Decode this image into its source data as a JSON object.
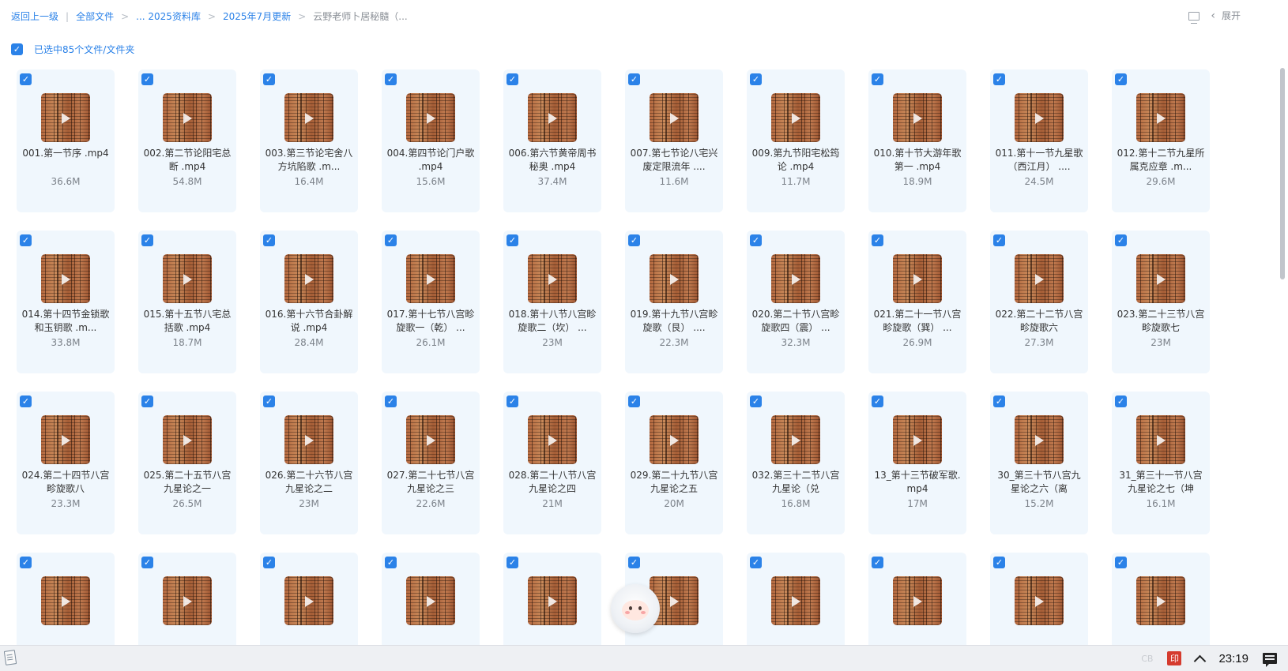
{
  "breadcrumb": {
    "back": "返回上一级",
    "sep1": "|",
    "all": "全部文件",
    "lib": "... 2025资料库",
    "month": "2025年7月更新",
    "current": "云野老师卜居秘髓（..."
  },
  "header": {
    "expand_label": "展开"
  },
  "selection": {
    "text": "已选中85个文件/文件夹"
  },
  "files": [
    {
      "name": "001.第一节序 .mp4",
      "size": "36.6M"
    },
    {
      "name": "002.第二节论阳宅总断 .mp4",
      "size": "54.8M"
    },
    {
      "name": "003.第三节论宅舍八方坑陷歌 .m...",
      "size": "16.4M"
    },
    {
      "name": "004.第四节论门户歌 .mp4",
      "size": "15.6M"
    },
    {
      "name": "006.第六节黄帝周书秘奥 .mp4",
      "size": "37.4M"
    },
    {
      "name": "007.第七节论八宅兴废定限流年 ....",
      "size": "11.6M"
    },
    {
      "name": "009.第九节阳宅松筠论 .mp4",
      "size": "11.7M"
    },
    {
      "name": "010.第十节大游年歌第一 .mp4",
      "size": "18.9M"
    },
    {
      "name": "011.第十一节九星歌（西江月） ....",
      "size": "24.5M"
    },
    {
      "name": "012.第十二节九星所属克应章 .m...",
      "size": "29.6M"
    },
    {
      "name": "014.第十四节金锁歌和玉钥歌 .m...",
      "size": "33.8M"
    },
    {
      "name": "015.第十五节八宅总括歌 .mp4",
      "size": "18.7M"
    },
    {
      "name": "016.第十六节合卦解说 .mp4",
      "size": "28.4M"
    },
    {
      "name": "017.第十七节八宫畛旋歌一（乾） ...",
      "size": "26.1M"
    },
    {
      "name": "018.第十八节八宫畛旋歌二（坎） ...",
      "size": "23M"
    },
    {
      "name": "019.第十九节八宫畛旋歌（艮） ....",
      "size": "22.3M"
    },
    {
      "name": "020.第二十节八宫畛旋歌四（震） ...",
      "size": "32.3M"
    },
    {
      "name": "021.第二十一节八宫畛旋歌（巽） ...",
      "size": "26.9M"
    },
    {
      "name": "022.第二十二节八宫畛旋歌六",
      "size": "27.3M"
    },
    {
      "name": "023.第二十三节八宫畛旋歌七",
      "size": "23M"
    },
    {
      "name": "024.第二十四节八宫畛旋歌八",
      "size": "23.3M"
    },
    {
      "name": "025.第二十五节八宫九星论之一",
      "size": "26.5M"
    },
    {
      "name": "026.第二十六节八宫九星论之二",
      "size": "23M"
    },
    {
      "name": "027.第二十七节八宫九星论之三",
      "size": "22.6M"
    },
    {
      "name": "028.第二十八节八宫九星论之四",
      "size": "21M"
    },
    {
      "name": "029.第二十九节八宫九星论之五",
      "size": "20M"
    },
    {
      "name": "032.第三十二节八宫九星论（兑",
      "size": "16.8M"
    },
    {
      "name": "13_第十三节破军歌.mp4",
      "size": "17M"
    },
    {
      "name": "30_第三十节八宫九星论之六（离",
      "size": "15.2M"
    },
    {
      "name": "31_第三十一节八宫九星论之七（坤",
      "size": "16.1M"
    },
    {
      "name": "",
      "size": ""
    },
    {
      "name": "",
      "size": ""
    },
    {
      "name": "",
      "size": ""
    },
    {
      "name": "",
      "size": ""
    },
    {
      "name": "",
      "size": ""
    },
    {
      "name": "",
      "size": ""
    },
    {
      "name": "",
      "size": ""
    },
    {
      "name": "",
      "size": ""
    },
    {
      "name": "",
      "size": ""
    },
    {
      "name": "",
      "size": ""
    }
  ],
  "icons": {
    "checkbox": "checkbox-checked-icon",
    "play": "play-icon",
    "view_toggle": "monitor-icon",
    "chevron": "chevron-left-icon"
  },
  "colors": {
    "accent": "#2b82e8",
    "card_bg": "#f0f7fd",
    "taskbar": "#eef0f3"
  },
  "taskbar": {
    "ime": "CB",
    "seal_char": "印",
    "time": "23:19"
  }
}
